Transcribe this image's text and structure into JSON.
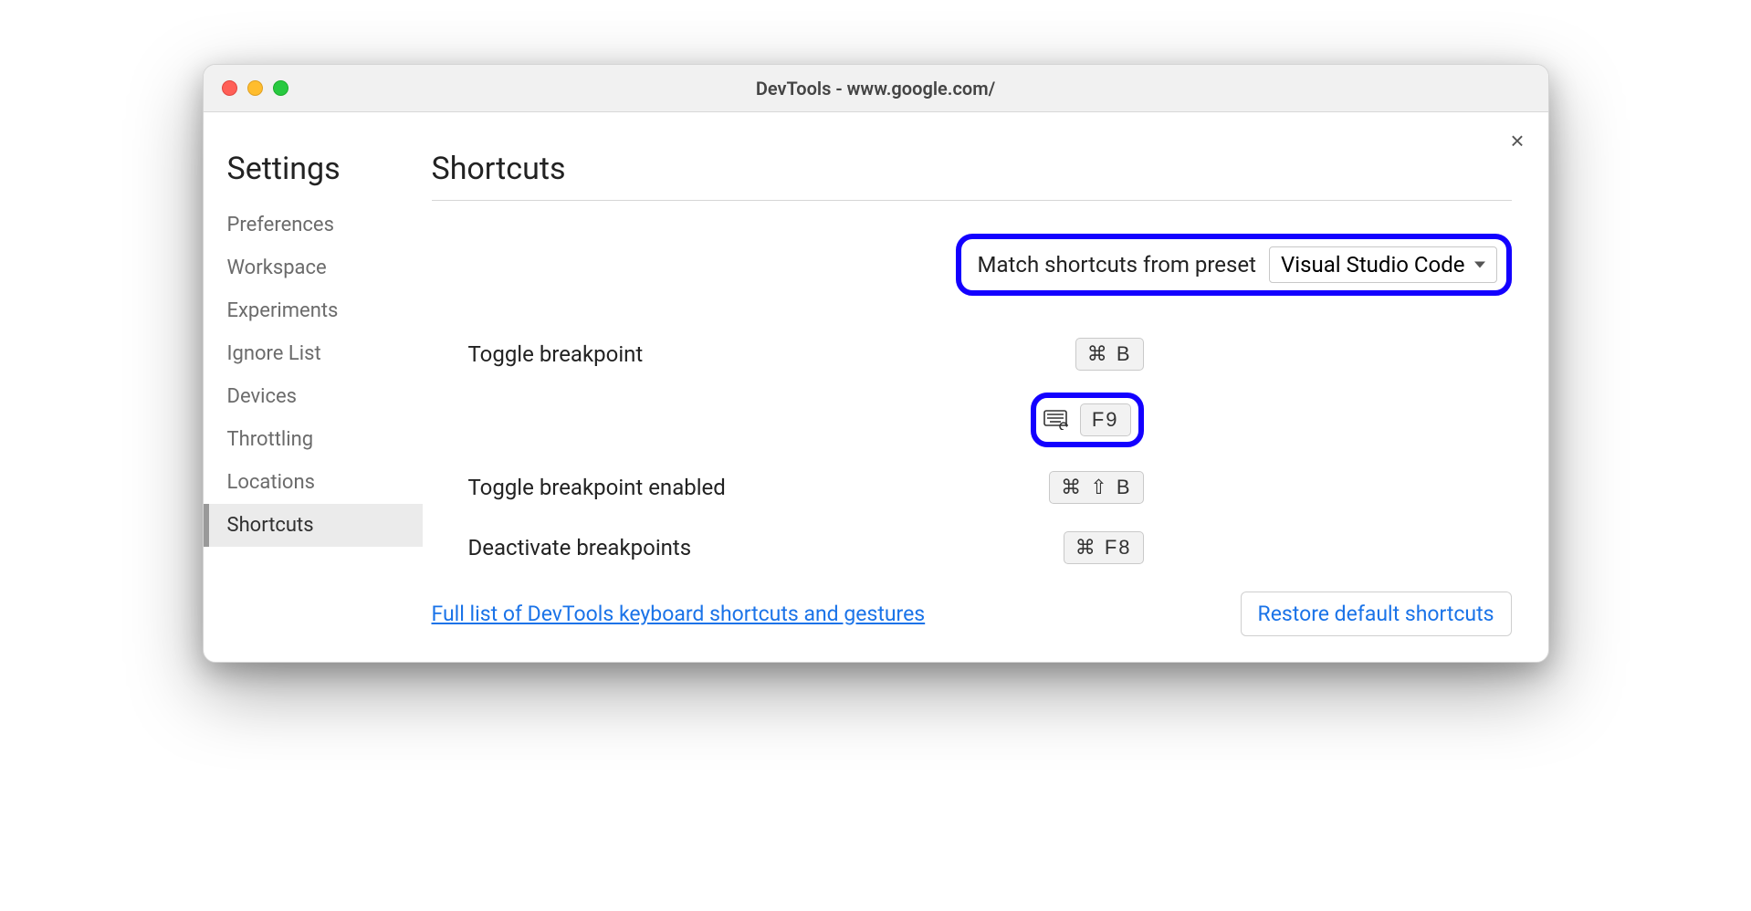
{
  "window": {
    "title": "DevTools - www.google.com/"
  },
  "sidebar": {
    "heading": "Settings",
    "items": [
      {
        "label": "Preferences"
      },
      {
        "label": "Workspace"
      },
      {
        "label": "Experiments"
      },
      {
        "label": "Ignore List"
      },
      {
        "label": "Devices"
      },
      {
        "label": "Throttling"
      },
      {
        "label": "Locations"
      },
      {
        "label": "Shortcuts",
        "active": true
      }
    ]
  },
  "main": {
    "heading": "Shortcuts",
    "preset": {
      "label": "Match shortcuts from preset",
      "selected": "Visual Studio Code"
    },
    "shortcuts": [
      {
        "label": "Toggle breakpoint",
        "keys": "⌘ B"
      },
      {
        "label": "",
        "keys": "F9",
        "highlighted": true,
        "icon": "keyboard-reset"
      },
      {
        "label": "Toggle breakpoint enabled",
        "keys": "⌘ ⇧ B"
      },
      {
        "label": "Deactivate breakpoints",
        "keys": "⌘ F8"
      }
    ],
    "link": "Full list of DevTools keyboard shortcuts and gestures",
    "restore": "Restore default shortcuts"
  },
  "colors": {
    "highlight": "#1300ff",
    "link": "#1a73e8"
  }
}
